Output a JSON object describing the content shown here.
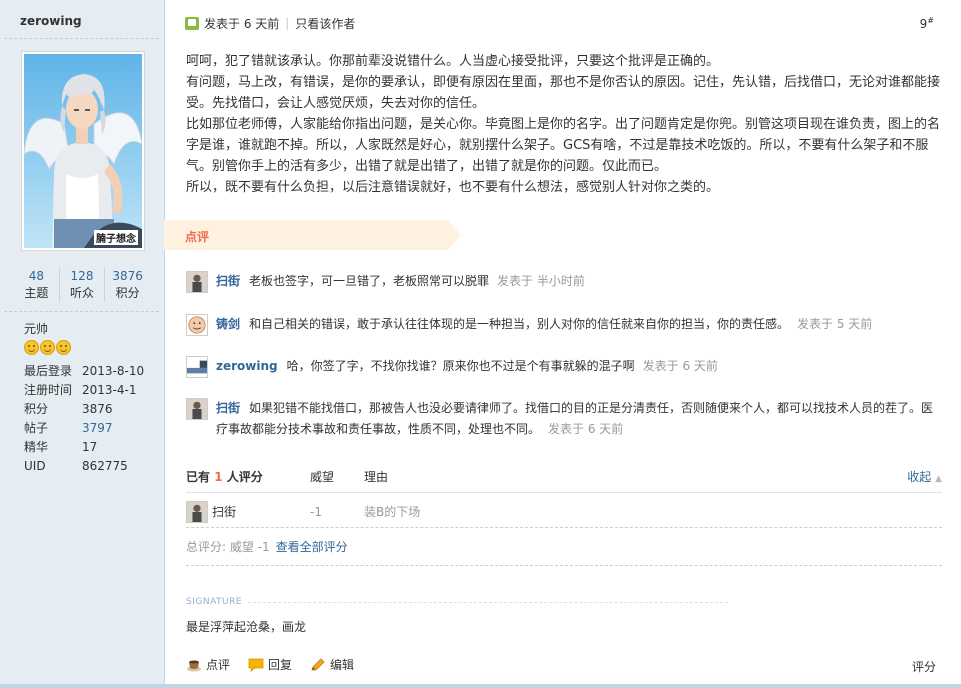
{
  "author": {
    "name": "zerowing",
    "stats": [
      {
        "num": "48",
        "label": "主题"
      },
      {
        "num": "128",
        "label": "听众"
      },
      {
        "num": "3876",
        "label": "积分"
      }
    ],
    "rank": "元帅",
    "medal_icons": [
      "smiley-icon",
      "smiley-icon",
      "smiley-icon"
    ],
    "info": [
      {
        "k": "最后登录",
        "v": "2013-8-10"
      },
      {
        "k": "注册时间",
        "v": "2013-4-1"
      },
      {
        "k": "积分",
        "v": "3876"
      },
      {
        "k": "帖子",
        "v": "3797"
      },
      {
        "k": "精华",
        "v": "17"
      },
      {
        "k": "UID",
        "v": "862775"
      }
    ],
    "avatar_caption": "腩子想念"
  },
  "post": {
    "posted": "发表于 6 天前",
    "author_only": "只看该作者",
    "floor": "9",
    "floor_sup": "#",
    "paragraphs": [
      "呵呵，犯了错就该承认。你那前辈没说错什么。人当虚心接受批评，只要这个批评是正确的。",
      "有问题，马上改，有错误，是你的要承认，即便有原因在里面，那也不是你否认的原因。记住，先认错，后找借口，无论对谁都能接受。先找借口，会让人感觉厌烦，失去对你的信任。",
      "比如那位老师傅，人家能给你指出问题，是关心你。毕竟图上是你的名字。出了问题肯定是你兜。别管这项目现在谁负责，图上的名字是谁，谁就跑不掉。所以，人家既然是好心，就别摆什么架子。GCS有啥，不过是靠技术吃饭的。所以，不要有什么架子和不服气。别管你手上的活有多少，出错了就是出错了，出错了就是你的问题。仅此而已。",
      "所以，既不要有什么负担，以后注意错误就好，也不要有什么想法，感觉别人针对你之类的。"
    ]
  },
  "comments_label": "点评",
  "comments": [
    {
      "name": "扫街",
      "text": "老板也签字，可一旦错了，老板照常可以脱罪",
      "time": "发表于 半小时前"
    },
    {
      "name": "铸剑",
      "text": "和自己相关的错误，敢于承认往往体现的是一种担当，别人对你的信任就来自你的担当，你的责任感。",
      "time": "发表于 5 天前"
    },
    {
      "name": "zerowing",
      "text": "哈，你签了字，不找你找谁？原来你也不过是个有事就躲的混子啊",
      "time": "发表于 6 天前"
    },
    {
      "name": "扫街",
      "text": "如果犯错不能找借口，那被告人也没必要请律师了。找借口的目的正是分清责任，否则随便来个人，都可以找技术人员的茬了。医疗事故都能分技术事故和责任事故，性质不同，处理也不同。",
      "time": "发表于 6 天前"
    }
  ],
  "rating": {
    "head_prefix": "已有",
    "head_count": "1",
    "head_suffix": "人评分",
    "col_weiwang": "威望",
    "col_reason": "理由",
    "collapse": "收起",
    "rows": [
      {
        "user": "扫街",
        "score": "-1",
        "reason": "装B的下场"
      }
    ],
    "total": "总评分: 威望 -1",
    "view_all": "查看全部评分"
  },
  "signature": {
    "label": "SIGNATURE",
    "text": "最是浮萍起沧桑，画龙"
  },
  "footer": {
    "dianping": "点评",
    "reply": "回复",
    "edit": "编辑",
    "pingfen": "评分"
  }
}
